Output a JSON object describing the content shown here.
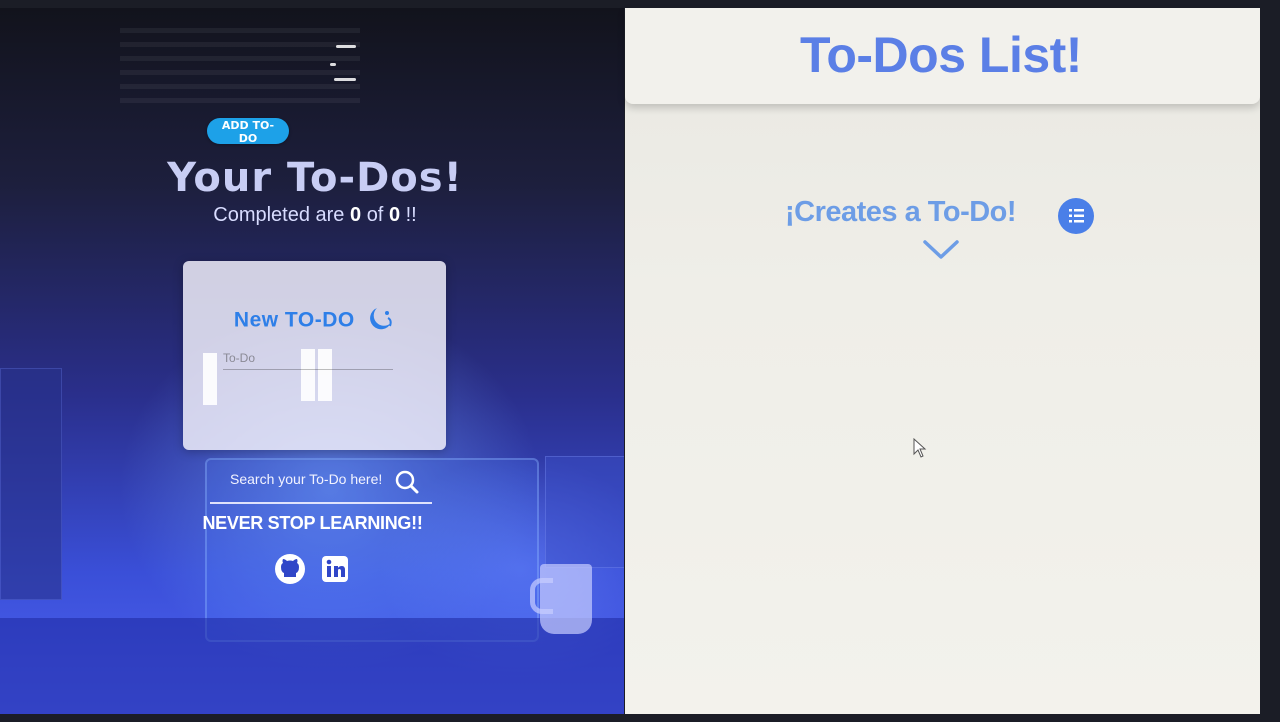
{
  "left": {
    "title": "Your To-Dos!",
    "completed": {
      "prefix": "Completed are",
      "done": "0",
      "of": "of",
      "total": "0",
      "suffix": "!!"
    },
    "new_todo": {
      "title": "New TO-DO",
      "input_placeholder": "To-Do",
      "add_label": "ADD TO-DO"
    },
    "search": {
      "label": "Search your To-Do here!"
    },
    "motto": "NEVER STOP LEARNING!!",
    "social_icons": [
      "github-icon",
      "linkedin-icon"
    ]
  },
  "right": {
    "title": "To-Dos List!",
    "empty_prompt": "¡Creates a To-Do!",
    "icons": [
      "list-icon",
      "chevron-down-icon"
    ]
  },
  "colors": {
    "accent_blue": "#5b7fe6",
    "prompt_blue": "#6d9de6",
    "button_cyan": "#1da1e8",
    "card_title_blue": "#2e7fe8"
  }
}
